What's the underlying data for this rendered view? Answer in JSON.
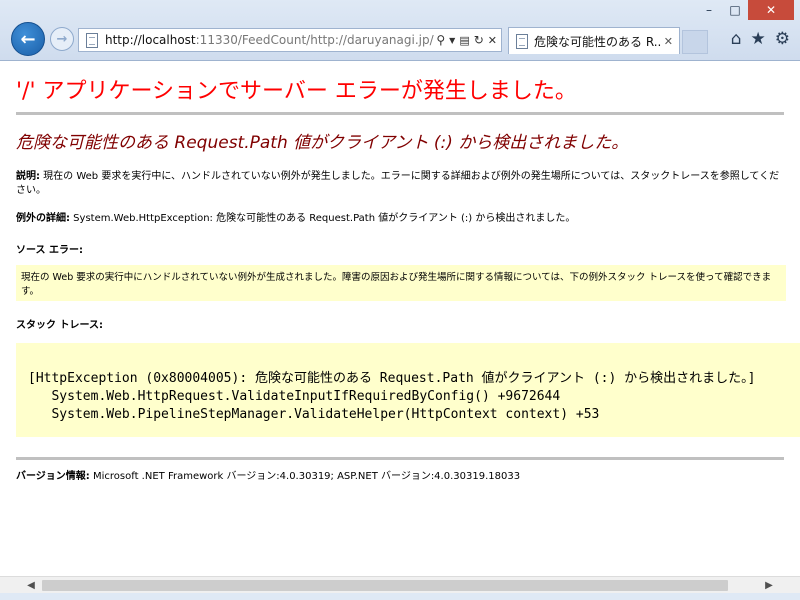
{
  "browser": {
    "window_controls": {
      "minimize": "–",
      "maximize": "□",
      "close": "✕"
    },
    "url_host": "http://localhost",
    "url_rest": ":11330/FeedCount/http://daruyanagi.jp/",
    "tab_title": "危険な可能性のある R...",
    "icons": {
      "back": "back-arrow-icon",
      "forward": "forward-arrow-icon",
      "search": "search-icon",
      "dropdown": "chevron-down-icon",
      "refresh": "refresh-icon",
      "home": "home-icon",
      "favorites": "star-icon",
      "tools": "gear-icon"
    }
  },
  "page": {
    "server_title": "'/' アプリケーションでサーバー エラーが発生しました。",
    "error_title": "危険な可能性のある Request.Path 値がクライアント (:) から検出されました。",
    "description_label": "説明:",
    "description_text": " 現在の Web 要求を実行中に、ハンドルされていない例外が発生しました。エラーに関する詳細および例外の発生場所については、スタックトレースを参照してください。",
    "exception_label": "例外の詳細:",
    "exception_text": " System.Web.HttpException: 危険な可能性のある Request.Path 値がクライアント (:) から検出されました。",
    "source_error_label": "ソース エラー:",
    "source_error_text": "現在の Web 要求の実行中にハンドルされていない例外が生成されました。障害の原因および発生場所に関する情報については、下の例外スタック トレースを使って確認できます。",
    "stack_trace_label": "スタック トレース:",
    "stack_lines": [
      "[HttpException (0x80004005): 危険な可能性のある Request.Path 値がクライアント (:) から検出されました。]",
      "   System.Web.HttpRequest.ValidateInputIfRequiredByConfig() +9672644",
      "   System.Web.PipelineStepManager.ValidateHelper(HttpContext context) +53"
    ],
    "version_label": "バージョン情報:",
    "version_text": " Microsoft .NET Framework バージョン:4.0.30319; ASP.NET バージョン:4.0.30319.18033"
  },
  "colors": {
    "server_title": "#ff0000",
    "error_title": "#800000",
    "code_background": "#ffffcc",
    "back_button": "#1b5fa8",
    "close_button": "#c74b3b"
  }
}
